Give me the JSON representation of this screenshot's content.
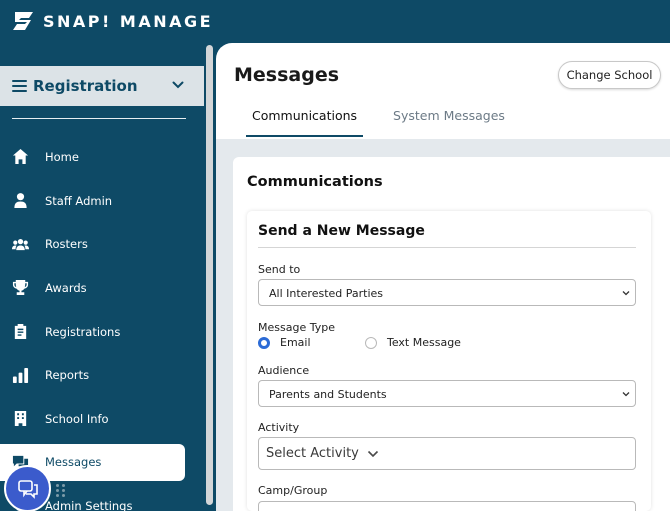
{
  "brand": {
    "name": "SNAP! MANAGE"
  },
  "sidebar": {
    "section": "Registration",
    "items": [
      {
        "label": "Home",
        "icon": "home-icon"
      },
      {
        "label": "Staff Admin",
        "icon": "person-icon"
      },
      {
        "label": "Rosters",
        "icon": "users-icon"
      },
      {
        "label": "Awards",
        "icon": "trophy-icon"
      },
      {
        "label": "Registrations",
        "icon": "clipboard-icon"
      },
      {
        "label": "Reports",
        "icon": "bar-chart-icon"
      },
      {
        "label": "School Info",
        "icon": "building-icon"
      },
      {
        "label": "Messages",
        "icon": "chat-icon"
      },
      {
        "label": "Admin Settings",
        "icon": "gear-icon"
      }
    ],
    "active_item": "Messages"
  },
  "header": {
    "title": "Messages",
    "change_school": "Change School",
    "tabs": [
      {
        "label": "Communications",
        "active": true
      },
      {
        "label": "System Messages",
        "active": false
      }
    ]
  },
  "communications": {
    "title": "Communications",
    "form": {
      "title": "Send a New Message",
      "send_to_label": "Send to",
      "send_to_value": "All Interested Parties",
      "message_type_label": "Message Type",
      "message_type_options": [
        "Email",
        "Text Message"
      ],
      "message_type_selected": "Email",
      "audience_label": "Audience",
      "audience_value": "Parents and Students",
      "activity_label": "Activity",
      "activity_value": "Select Activity",
      "camp_group_label": "Camp/Group"
    }
  },
  "colors": {
    "primary": "#0e4a66",
    "accent": "#2c6bd6",
    "chat": "#3b5bcc"
  }
}
